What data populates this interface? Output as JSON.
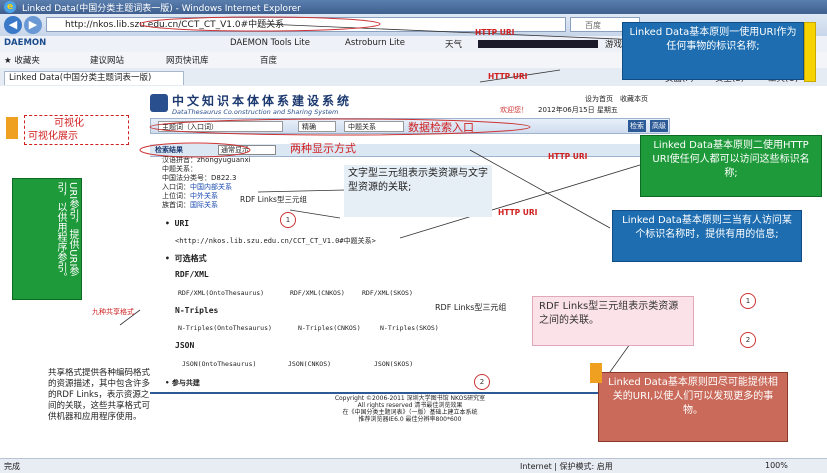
{
  "window": {
    "title": "Linked Data(中国分类主题词表一版) - Windows Internet Explorer"
  },
  "address": {
    "url": "http://nkos.lib.szu.edu.cn/CCT_CT_V1.0#中题关系",
    "search_placeholder": "百度"
  },
  "toolbar1": {
    "items": [
      "DAEMON Tools Lite",
      "Astroburn Lite",
      "天气",
      "游戏"
    ]
  },
  "toolbar2": {
    "favorites": "收藏夹",
    "items": [
      "建议网站",
      "网页快讯库",
      "百度"
    ]
  },
  "tab": {
    "label": "Linked Data(中国分类主题词表一版)",
    "right_items": [
      "页面(P)",
      "安全(S)",
      "工具(O)"
    ]
  },
  "site": {
    "logo_title": "中文知识本体体系建设系统",
    "logo_subtitle": "DataThesaurus Co.onstruction and Sharing System",
    "top_links": [
      "设为首页",
      "收藏本页"
    ],
    "welcome": "欢迎您！",
    "date": "2012年06月15日 星期五",
    "search_select1": "主题词（入口词）",
    "search_select2": "精确",
    "search_select3": "中题关系",
    "search_button": "检索",
    "advanced": "高级",
    "tabs": [
      "检索结果",
      "通常显示"
    ],
    "fields": [
      {
        "k": "汉语拼音：",
        "v": "zhongyuguanxi"
      },
      {
        "k": "中题关系：",
        "v": ""
      },
      {
        "k": "中国法分类号：",
        "v": "D822.3"
      },
      {
        "k": "入口词：",
        "v": "中国内部关系"
      },
      {
        "k": "上位词：",
        "v": "中外关系"
      },
      {
        "k": "族首词：",
        "v": "国际关系"
      }
    ],
    "uri_head": "URI",
    "uri_value": "<http://nkos.lib.szu.edu.cn/CCT_CT_V1.0#中题关系>",
    "formats_head": "可选格式",
    "rdf_head": "RDF/XML",
    "rdf_links": [
      "RDF/XML(OntoThesaurus)",
      "RDF/XML(CNKOS)",
      "RDF/XML(SKOS)"
    ],
    "nt_head": "N-Triples",
    "nt_links": [
      "N-Triples(OntoThesaurus)",
      "N-Triples(CNKOS)",
      "N-Triples(SKOS)"
    ],
    "json_head": "JSON",
    "json_links": [
      "JSON(OntoThesaurus)",
      "JSON(CNKOS)",
      "JSON(SKOS)"
    ],
    "join": "参与共建",
    "footer1": "Copyright ©2006-2011 深圳大学图书馆 NKOS研究室",
    "footer2": "All rights reserved 清书最佳浏览效果",
    "footer3": "在《中国分类主题词表》（一版）基础上建立本系统",
    "footer4": "推荐浏览器IE6.0 最佳分辨率800*600"
  },
  "annotations": {
    "principle1": "Linked Data基本原则一使用URI作为任何事物的标识名称;",
    "principle2": "Linked Data基本原则二使用HTTP URI使任何人都可以访问这些标识名称;",
    "principle3": "Linked Data基本原则三当有人访问某个标识名称时，提供有用的信息;",
    "principle4": "Linked Data基本原则四尽可能提供相关的URI,以使人们可以发现更多的事物。",
    "visual": "可视化",
    "visual_show": "可视化展示",
    "search_entry": "数据检索入口",
    "two_modes": "两种显示方式",
    "text_triple": "文字型三元组表示类资源与文字型资源的关联;",
    "rdf_triple_small": "RDF Links型三元组",
    "rdf_triple_mid": "RDF Links型三元组",
    "rdf_triple_big": "RDF Links型三元组表示类资源之间的关联。",
    "uri_side": "URI参引，提供URI参引，以供用程序参引。",
    "nine_formats": "九种共享格式",
    "share_format": "共享格式提供各种编码格式的资源描述，其中包含许多的RDF Links，表示资源之间的关联，这些共享格式可供机器和应用程序使用。",
    "http_uri_labels": [
      "HTTP URI",
      "HTTP URI",
      "HTTP URI",
      "HTTP URI"
    ],
    "circle_labels": [
      "1",
      "2",
      "1",
      "2"
    ]
  },
  "status": {
    "left": "完成",
    "zone": "Internet | 保护模式: 启用",
    "zoom": "100%"
  }
}
